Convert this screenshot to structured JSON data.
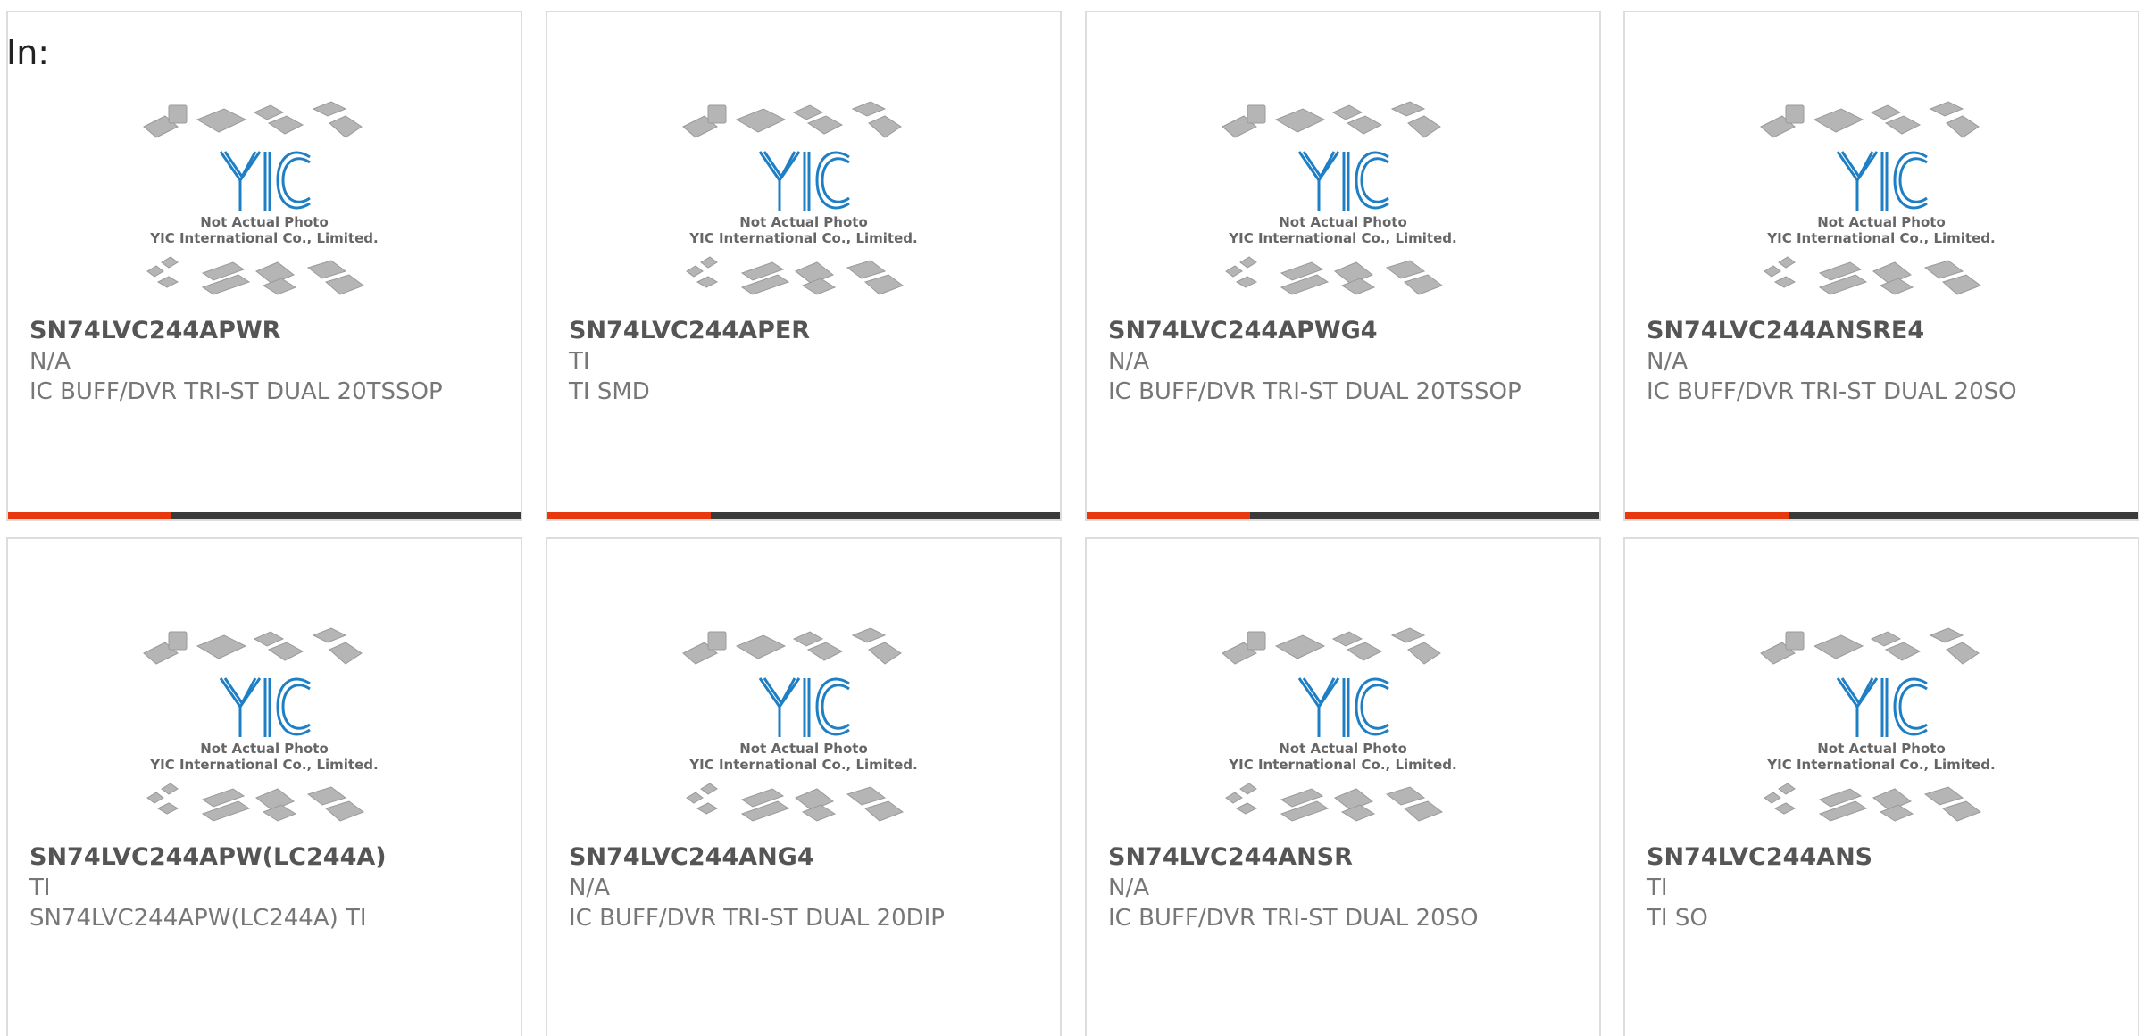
{
  "header": {
    "in_label": "In:"
  },
  "photo": {
    "caption_line1": "Not Actual Photo",
    "caption_line2": "YIC International Co., Limited.",
    "logo_text": "YIC"
  },
  "colors": {
    "accent": "#e8380d",
    "bar_dark": "#3a3a3a",
    "logo_blue": "#1f7fc4",
    "part_gray": "#aaaaaa"
  },
  "products": [
    {
      "part": "SN74LVC244APWR",
      "mfr": "N/A",
      "desc": "IC BUFF/DVR TRI-ST DUAL 20TSSOP"
    },
    {
      "part": "SN74LVC244APER",
      "mfr": "TI",
      "desc": "TI SMD"
    },
    {
      "part": "SN74LVC244APWG4",
      "mfr": "N/A",
      "desc": "IC BUFF/DVR TRI-ST DUAL 20TSSOP"
    },
    {
      "part": "SN74LVC244ANSRE4",
      "mfr": "N/A",
      "desc": "IC BUFF/DVR TRI-ST DUAL 20SO"
    },
    {
      "part": "SN74LVC244APW(LC244A)",
      "mfr": "TI",
      "desc": "SN74LVC244APW(LC244A) TI"
    },
    {
      "part": "SN74LVC244ANG4",
      "mfr": "N/A",
      "desc": "IC BUFF/DVR TRI-ST DUAL 20DIP"
    },
    {
      "part": "SN74LVC244ANSR",
      "mfr": "N/A",
      "desc": "IC BUFF/DVR TRI-ST DUAL 20SO"
    },
    {
      "part": "SN74LVC244ANS",
      "mfr": "TI",
      "desc": "TI SO"
    }
  ]
}
